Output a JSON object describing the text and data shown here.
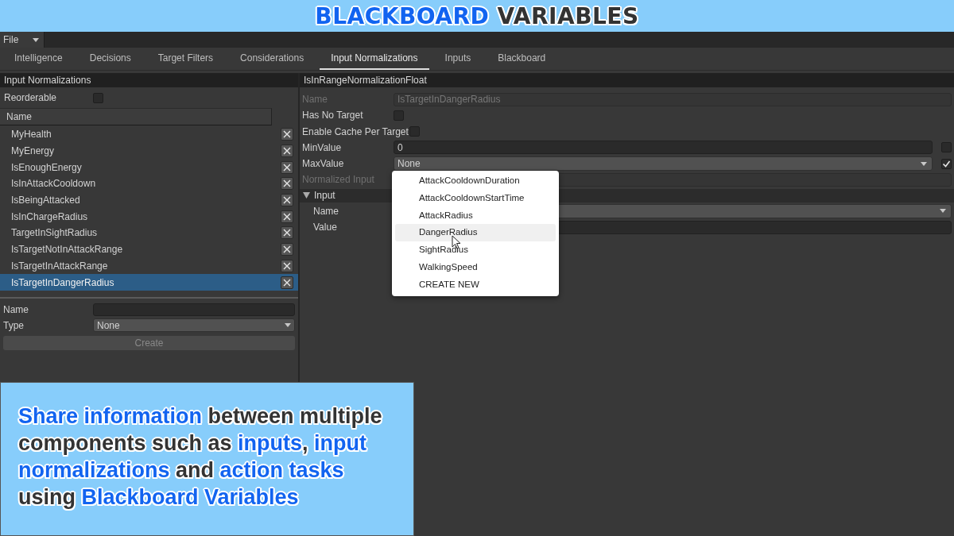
{
  "banner": {
    "title": "**BLACKBOARD** VARIABLES"
  },
  "menu": {
    "label": "File"
  },
  "tabs": [
    {
      "label": "Intelligence",
      "selected": false
    },
    {
      "label": "Decisions",
      "selected": false
    },
    {
      "label": "Target Filters",
      "selected": false
    },
    {
      "label": "Considerations",
      "selected": false
    },
    {
      "label": "Input Normalizations",
      "selected": true
    },
    {
      "label": "Inputs",
      "selected": false
    },
    {
      "label": "Blackboard",
      "selected": false
    }
  ],
  "left_panel": {
    "title": "Input Normalizations",
    "reorderable": {
      "label": "Reorderable",
      "checked": false
    },
    "column": "Name",
    "items": [
      {
        "name": "MyHealth",
        "selected": false
      },
      {
        "name": "MyEnergy",
        "selected": false
      },
      {
        "name": "IsEnoughEnergy",
        "selected": false
      },
      {
        "name": "IsInAttackCooldown",
        "selected": false
      },
      {
        "name": "IsBeingAttacked",
        "selected": false
      },
      {
        "name": "IsInChargeRadius",
        "selected": false
      },
      {
        "name": "TargetInSightRadius",
        "selected": false
      },
      {
        "name": "IsTargetNotInAttackRange",
        "selected": false
      },
      {
        "name": "IsTargetInAttackRange",
        "selected": false
      },
      {
        "name": "IsTargetInDangerRadius",
        "selected": true
      }
    ],
    "form": {
      "name_label": "Name",
      "type_label": "Type",
      "type_value": "None",
      "create_button": "Create",
      "create_disabled": true
    }
  },
  "inspector": {
    "title": "IsInRangeNormalizationFloat",
    "fields": [
      {
        "kind": "text",
        "label": "Name",
        "value": "IsTargetInDangerRadius",
        "disabled": true
      },
      {
        "kind": "checkbox",
        "label": "Has No Target",
        "checked": false,
        "disabled": false
      },
      {
        "kind": "checkbox",
        "label": "Enable Cache Per Target",
        "checked": false,
        "disabled": false
      },
      {
        "kind": "text",
        "label": "MinValue",
        "value": "0",
        "disabled": false,
        "toggle": false
      },
      {
        "kind": "dropdown",
        "label": "MaxValue",
        "value": "None",
        "disabled": false,
        "toggle": true
      },
      {
        "kind": "text",
        "label": "Normalized Input",
        "disabled": true
      },
      {
        "kind": "foldout",
        "label": "Input",
        "expanded": true,
        "children": [
          {
            "kind": "dropdown",
            "label": "Name",
            "disabled": false
          },
          {
            "kind": "text",
            "label": "Value",
            "disabled": false
          }
        ]
      }
    ]
  },
  "popup": {
    "items": [
      {
        "label": "AttackCooldownDuration",
        "hovered": false
      },
      {
        "label": "AttackCooldownStartTime",
        "hovered": false
      },
      {
        "label": "AttackRadius",
        "hovered": false
      },
      {
        "label": "DangerRadius",
        "hovered": true
      },
      {
        "label": "SightRadius",
        "hovered": false
      },
      {
        "label": "WalkingSpeed",
        "hovered": false
      },
      {
        "label": "CREATE NEW",
        "hovered": false
      }
    ]
  },
  "caption": "**Share information** between multiple components such as **inputs**, **input normalizations** and **action tasks** using **Blackboard Variables**"
}
